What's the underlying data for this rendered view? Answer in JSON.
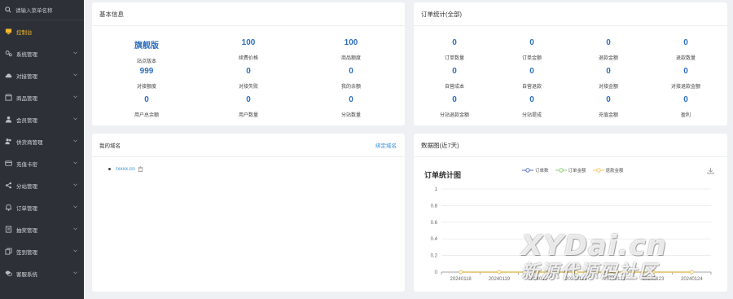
{
  "sidebar": {
    "search_placeholder": "请输入菜单名称",
    "items": [
      {
        "label": "控制台",
        "icon": "monitor-icon"
      },
      {
        "label": "系统管理",
        "icon": "gears-icon"
      },
      {
        "label": "对接管理",
        "icon": "cloud-icon"
      },
      {
        "label": "商品管理",
        "icon": "shop-icon"
      },
      {
        "label": "会员管理",
        "icon": "user-icon"
      },
      {
        "label": "供货商管理",
        "icon": "users-icon"
      },
      {
        "label": "充值卡密",
        "icon": "card-icon"
      },
      {
        "label": "分站管理",
        "icon": "share-icon"
      },
      {
        "label": "订单管理",
        "icon": "bell-icon"
      },
      {
        "label": "抽奖管理",
        "icon": "book-icon"
      },
      {
        "label": "签到管理",
        "icon": "copy-icon"
      },
      {
        "label": "客服系统",
        "icon": "chat-icon"
      }
    ],
    "active_color": "#f5b92f"
  },
  "basic": {
    "title": "基本信息",
    "stats": [
      {
        "value": "旗舰版",
        "label": "站点版本"
      },
      {
        "value": "100",
        "label": "续费价格"
      },
      {
        "value": "100",
        "label": "商品额度"
      },
      {
        "value": "999",
        "label": "对接额度"
      },
      {
        "value": "0",
        "label": "对接失败"
      },
      {
        "value": "0",
        "label": "我的余额"
      },
      {
        "value": "0",
        "label": "用户总余额"
      },
      {
        "value": "0",
        "label": "用户数量"
      },
      {
        "value": "0",
        "label": "分站数量"
      }
    ]
  },
  "orders": {
    "title": "订单统计(全部)",
    "stats": [
      {
        "value": "0",
        "label": "订单数量"
      },
      {
        "value": "0",
        "label": "订单金额"
      },
      {
        "value": "0",
        "label": "退款金额"
      },
      {
        "value": "0",
        "label": "退款数量"
      },
      {
        "value": "0",
        "label": "自营成本"
      },
      {
        "value": "0",
        "label": "自营退款"
      },
      {
        "value": "0",
        "label": "对接金额"
      },
      {
        "value": "0",
        "label": "对接退款金额"
      },
      {
        "value": "0",
        "label": "分站退款金额"
      },
      {
        "value": "0",
        "label": "分站提成"
      },
      {
        "value": "0",
        "label": "充值金额"
      },
      {
        "value": "0",
        "label": "盈利"
      }
    ]
  },
  "domains": {
    "title": "我的域名",
    "bind_label": "绑定域名",
    "items": [
      "rxxxx.cn"
    ]
  },
  "chart_panel": {
    "title": "数据图(近7天)"
  },
  "chart_data": {
    "type": "line",
    "title": "订单统计图",
    "x": [
      "20240118",
      "20240119",
      "20240120",
      "20240121",
      "20240122",
      "20240123",
      "20240124"
    ],
    "x_tick_labels_visible": [
      "20240118",
      "20240119",
      "2024012",
      "20240121",
      "20240122",
      "20240123",
      "20240124"
    ],
    "series": [
      {
        "name": "订单数",
        "color": "#5470c6",
        "values": [
          0,
          0,
          0,
          0,
          0,
          0,
          0
        ]
      },
      {
        "name": "订单金额",
        "color": "#91cc75",
        "values": [
          0,
          0,
          0,
          0,
          0,
          0,
          0
        ]
      },
      {
        "name": "退款金额",
        "color": "#fac858",
        "values": [
          0,
          0,
          0,
          0,
          0,
          0,
          0
        ]
      }
    ],
    "yticks": [
      "0",
      "0.2",
      "0.4",
      "0.6",
      "0.8",
      "1"
    ],
    "ylim": [
      0,
      1
    ],
    "legend": "top-center",
    "grid": true
  },
  "watermark": {
    "line1": "XYDai.cn",
    "line2": "新源代源码社区"
  }
}
